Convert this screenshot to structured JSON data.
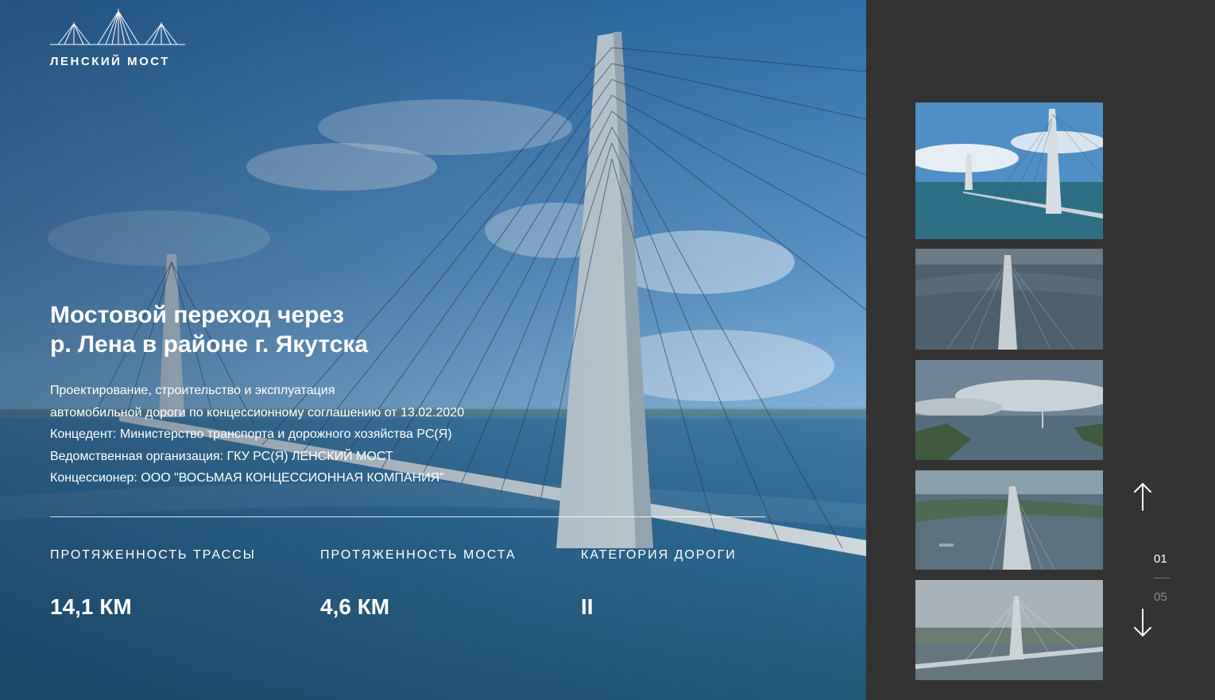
{
  "brand": {
    "logo_text": "ЛЕНСКИЙ МОСТ"
  },
  "hero": {
    "title_line1": "Мостовой переход через",
    "title_line2": "р. Лена в районе г. Якутска",
    "description": [
      "Проектирование, строительство и эксплуатация",
      "автомобильной дороги по концессионному соглашению от 13.02.2020",
      "Концедент: Министерство транспорта и дорожного хозяйства РС(Я)",
      "Ведомственная организация: ГКУ РС(Я) ЛЕНСКИЙ МОСТ",
      "Концессионер: ООО \"ВОСЬМАЯ КОНЦЕССИОННАЯ КОМПАНИЯ\""
    ]
  },
  "stats": [
    {
      "label": "ПРОТЯЖЕННОСТЬ ТРАССЫ",
      "value": "14,1 КМ"
    },
    {
      "label": "ПРОТЯЖЕННОСТЬ МОСТА",
      "value": "4,6 КМ"
    },
    {
      "label": "КАТЕГОРИЯ ДОРОГИ",
      "value": "II"
    }
  ],
  "slider": {
    "current": "01",
    "total": "05",
    "up_icon": "arrow-up-icon",
    "down_icon": "arrow-down-icon"
  },
  "colors": {
    "sidebar_bg": "#333333",
    "text": "#ffffff",
    "muted": "#8a8a8a"
  }
}
